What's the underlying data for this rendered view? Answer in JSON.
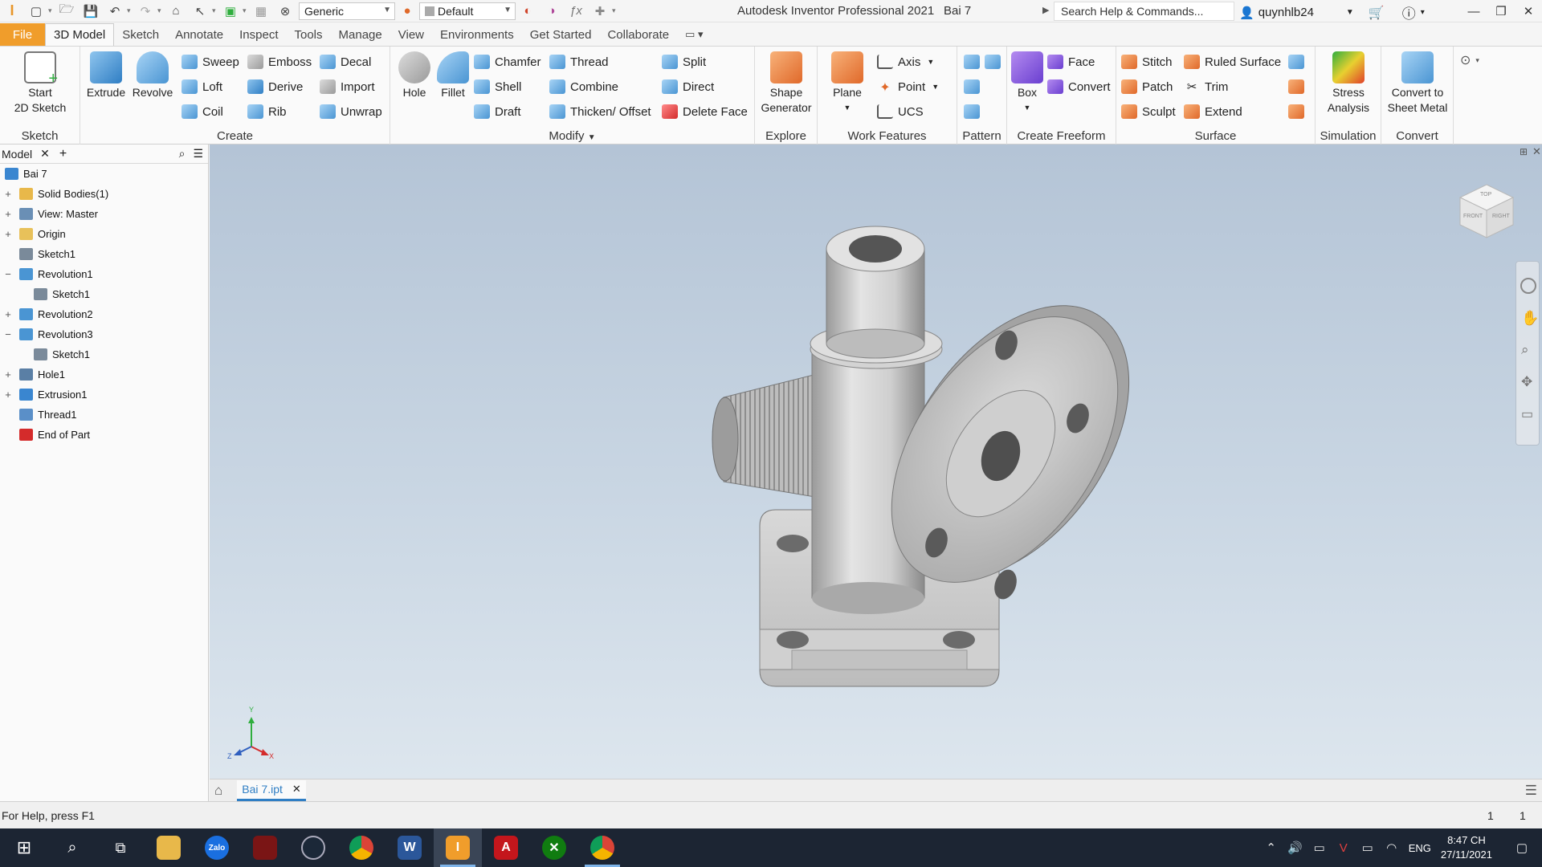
{
  "titlebar": {
    "style_combo": "Generic",
    "appearance_combo": "Default",
    "app_title": "Autodesk Inventor Professional 2021",
    "doc_title": "Bai 7",
    "search_placeholder": "Search Help & Commands...",
    "user": "quynhlb24"
  },
  "tabs": [
    "File",
    "3D Model",
    "Sketch",
    "Annotate",
    "Inspect",
    "Tools",
    "Manage",
    "View",
    "Environments",
    "Get Started",
    "Collaborate"
  ],
  "ribbon": {
    "sketch": {
      "title": "Sketch",
      "start_sketch": "Start\n2D Sketch"
    },
    "create": {
      "title": "Create",
      "extrude": "Extrude",
      "revolve": "Revolve",
      "sweep": "Sweep",
      "emboss": "Emboss",
      "decal": "Decal",
      "loft": "Loft",
      "derive": "Derive",
      "import": "Import",
      "coil": "Coil",
      "rib": "Rib",
      "unwrap": "Unwrap"
    },
    "modify": {
      "title": "Modify",
      "hole": "Hole",
      "fillet": "Fillet",
      "chamfer": "Chamfer",
      "thread": "Thread",
      "split": "Split",
      "shell": "Shell",
      "combine": "Combine",
      "direct": "Direct",
      "draft": "Draft",
      "thicken": "Thicken/ Offset",
      "delete_face": "Delete Face"
    },
    "explore": {
      "title": "Explore",
      "shape_generator": "Shape\nGenerator"
    },
    "work_features": {
      "title": "Work Features",
      "plane": "Plane",
      "axis": "Axis",
      "point": "Point",
      "ucs": "UCS"
    },
    "pattern": {
      "title": "Pattern"
    },
    "freeform": {
      "title": "Create Freeform",
      "box": "Box",
      "face": "Face",
      "convert": "Convert"
    },
    "surface": {
      "title": "Surface",
      "stitch": "Stitch",
      "ruled": "Ruled Surface",
      "patch": "Patch",
      "trim": "Trim",
      "sculpt": "Sculpt",
      "extend": "Extend"
    },
    "simulation": {
      "title": "Simulation",
      "stress": "Stress\nAnalysis"
    },
    "convert": {
      "title": "Convert",
      "sheet_metal": "Convert to\nSheet Metal"
    }
  },
  "browser": {
    "tab": "Model",
    "items": [
      {
        "label": "Bai 7",
        "expander": "",
        "level": 0,
        "icon_color": "#3a86d0"
      },
      {
        "label": "Solid Bodies(1)",
        "expander": "+",
        "level": 1,
        "icon_color": "#e8b84a"
      },
      {
        "label": "View: Master",
        "expander": "+",
        "level": 1,
        "icon_color": "#6a8fb5"
      },
      {
        "label": "Origin",
        "expander": "+",
        "level": 1,
        "icon_color": "#e8c15a"
      },
      {
        "label": "Sketch1",
        "expander": "",
        "level": 1,
        "icon_color": "#7a8a9a"
      },
      {
        "label": "Revolution1",
        "expander": "−",
        "level": 1,
        "icon_color": "#4a95d3"
      },
      {
        "label": "Sketch1",
        "expander": "",
        "level": 2,
        "icon_color": "#7a8a9a"
      },
      {
        "label": "Revolution2",
        "expander": "+",
        "level": 1,
        "icon_color": "#4a95d3"
      },
      {
        "label": "Revolution3",
        "expander": "−",
        "level": 1,
        "icon_color": "#4a95d3"
      },
      {
        "label": "Sketch1",
        "expander": "",
        "level": 2,
        "icon_color": "#7a8a9a"
      },
      {
        "label": "Hole1",
        "expander": "+",
        "level": 1,
        "icon_color": "#5a7fa5"
      },
      {
        "label": "Extrusion1",
        "expander": "+",
        "level": 1,
        "icon_color": "#3a86d0"
      },
      {
        "label": "Thread1",
        "expander": "",
        "level": 1,
        "icon_color": "#5a8fc8"
      },
      {
        "label": "End of Part",
        "expander": "",
        "level": 1,
        "icon_color": "#d42b2b"
      }
    ]
  },
  "viewcube": {
    "top": "TOP",
    "front": "FRONT",
    "right": "RIGHT"
  },
  "triad": {
    "x": "X",
    "y": "Y",
    "z": "Z"
  },
  "doc_tab": "Bai 7.ipt",
  "status": {
    "help": "For Help, press F1",
    "count1": "1",
    "count2": "1"
  },
  "taskbar": {
    "apps": [
      "Zalo",
      "A"
    ],
    "lang": "ENG",
    "time": "8:47 CH",
    "date": "27/11/2021"
  }
}
